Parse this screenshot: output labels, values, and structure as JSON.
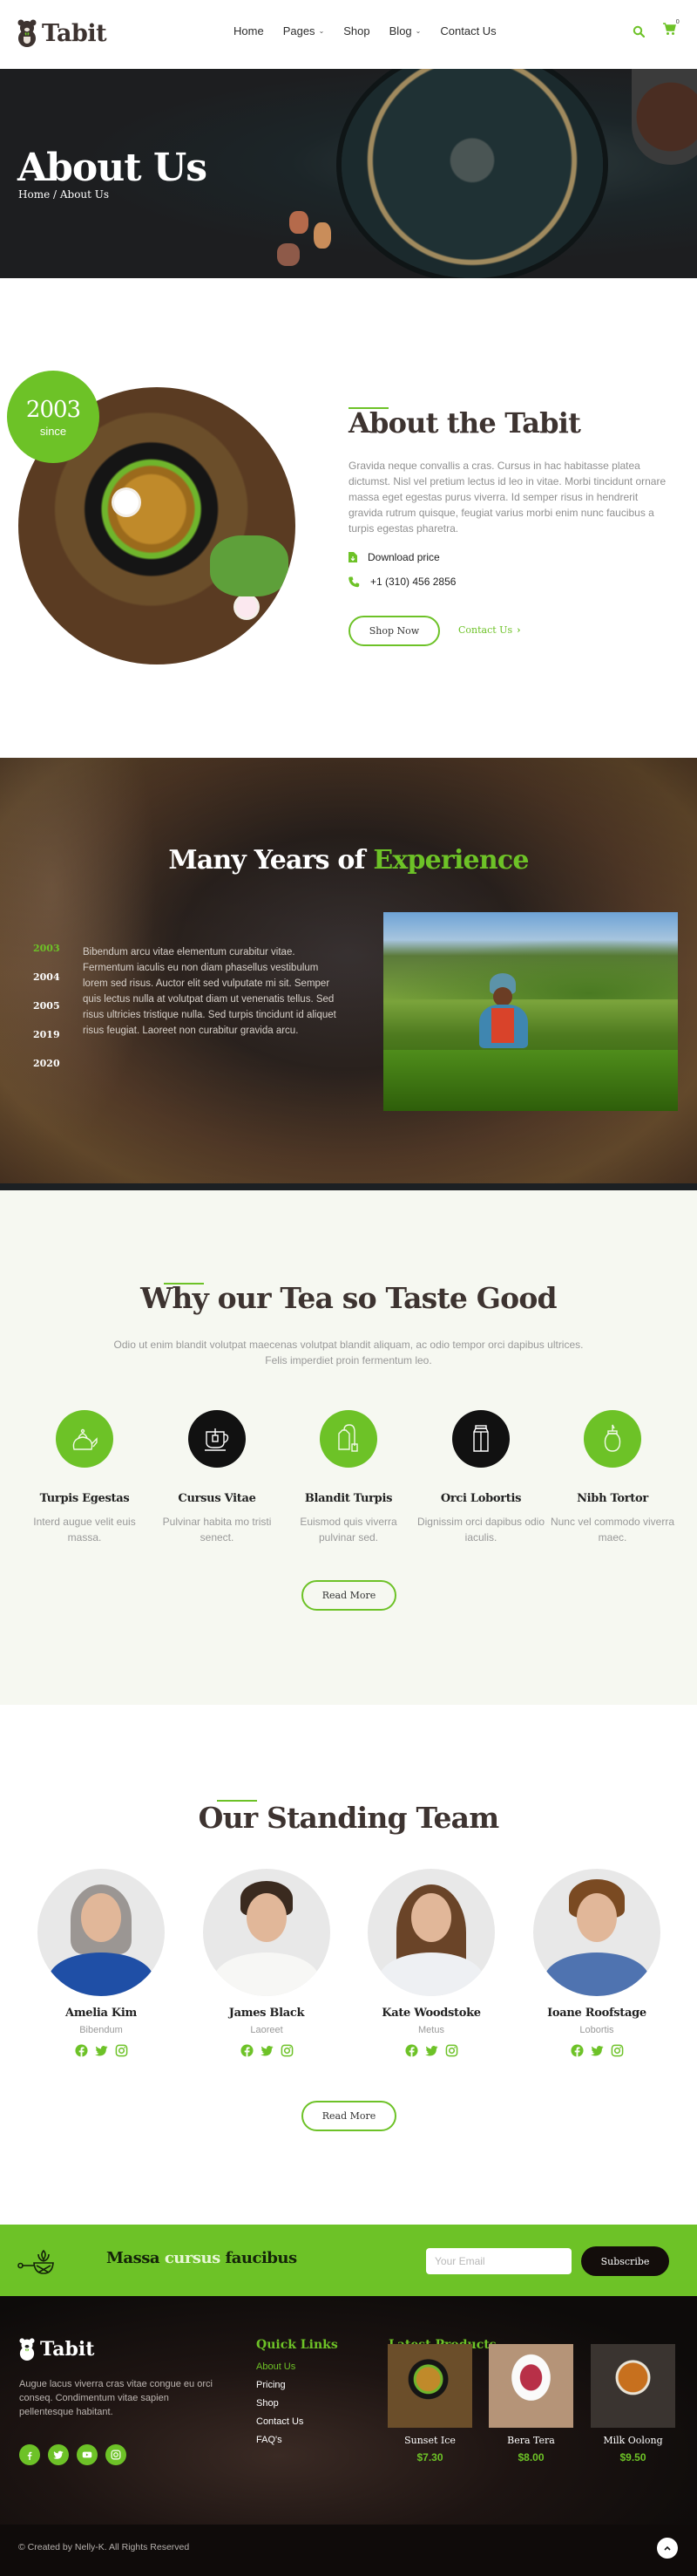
{
  "brand": {
    "name": "Tabit",
    "accent": "#6dc227",
    "dark": "#3d3330"
  },
  "nav": {
    "items": [
      {
        "label": "Home",
        "dropdown": false
      },
      {
        "label": "Pages",
        "dropdown": true
      },
      {
        "label": "Shop",
        "dropdown": false
      },
      {
        "label": "Blog",
        "dropdown": true
      },
      {
        "label": "Contact Us",
        "dropdown": false
      }
    ],
    "cart_count": "0",
    "icons": [
      "search-icon",
      "cart-icon"
    ]
  },
  "hero": {
    "title": "About Us",
    "breadcrumb": "Home / About Us"
  },
  "about": {
    "since_year": "2003",
    "since_label": "since",
    "title": "About the Tabit",
    "text": "Gravida neque convallis a cras. Cursus in hac habitasse platea dictumst. Nisl vel pretium lectus id leo in vitae. Morbi tincidunt ornare massa eget egestas purus viverra. Id semper risus in hendrerit gravida rutrum quisque, feugiat varius morbi enim nunc faucibus a turpis egestas pharetra.",
    "download_label": "Download price",
    "phone": "+1 (310) 456 2856",
    "shop_button": "Shop Now",
    "contact_link": "Contact Us"
  },
  "experience": {
    "title_main": "Many Years of",
    "title_accent": "Experience",
    "years": [
      "2003",
      "2004",
      "2005",
      "2019",
      "2020"
    ],
    "active_year": "2003",
    "text": "Bibendum arcu vitae elementum curabitur vitae. Fermentum iaculis eu non diam phasellus vestibulum lorem sed risus. Auctor elit sed vulputate mi sit. Semper quis lectus nulla at volutpat diam ut venenatis tellus. Sed risus ultricies tristique nulla. Sed turpis tincidunt id aliquet risus feugiat. Laoreet non curabitur gravida arcu."
  },
  "why": {
    "title": "Why our Tea so Taste Good",
    "subtitle": "Odio ut enim blandit volutpat maecenas volutpat blandit aliquam, ac odio tempor orci dapibus ultrices. Felis imperdiet proin fermentum leo.",
    "features": [
      {
        "icon": "kettle-icon",
        "title": "Turpis Egestas",
        "text": "Interd augue velit euis massa.",
        "color": "#6dc227"
      },
      {
        "icon": "tea-cup-icon",
        "title": "Cursus Vitae",
        "text": "Pulvinar habita mo tristi senect.",
        "color": "#111111"
      },
      {
        "icon": "tea-bag-icon",
        "title": "Blandit Turpis",
        "text": "Euismod quis viverra pulvinar sed.",
        "color": "#6dc227"
      },
      {
        "icon": "milk-carton-icon",
        "title": "Orci Lobortis",
        "text": "Dignissim orci dapibus odio iaculis.",
        "color": "#111111"
      },
      {
        "icon": "sugar-jar-icon",
        "title": "Nibh Tortor",
        "text": "Nunc vel commodo viverra maec.",
        "color": "#6dc227"
      }
    ],
    "button": "Read More"
  },
  "team": {
    "title": "Our Standing Team",
    "members": [
      {
        "name": "Amelia Kim",
        "role": "Bibendum"
      },
      {
        "name": "James Black",
        "role": "Laoreet"
      },
      {
        "name": "Kate Woodstoke",
        "role": "Metus"
      },
      {
        "name": "Ioane Roofstage",
        "role": "Lobortis"
      }
    ],
    "socials": [
      "facebook-icon",
      "twitter-icon",
      "instagram-icon"
    ],
    "button": "Read More"
  },
  "newsletter": {
    "title_a": "Massa",
    "title_b": "cursus",
    "title_c": "faucibus",
    "email_placeholder": "Your Email",
    "button": "Subscribe"
  },
  "footer": {
    "brand": "Tabit",
    "text": "Augue lacus viverra cras vitae congue eu orci conseq. Condimentum vitae sapien pellentesque habitant.",
    "socials": [
      "facebook-icon",
      "twitter-icon",
      "youtube-icon",
      "instagram-icon"
    ],
    "quick_links_title": "Quick Links",
    "quick_links": [
      "About Us",
      "Pricing",
      "Shop",
      "Contact Us",
      "FAQ's"
    ],
    "active_link": "About Us",
    "products_title": "Latest Products",
    "products": [
      {
        "name": "Sunset Ice",
        "price": "$7.30"
      },
      {
        "name": "Bera Tera",
        "price": "$8.00"
      },
      {
        "name": "Milk Oolong",
        "price": "$9.50"
      }
    ],
    "copyright": "© Created by Nelly-K. All Rights Reserved"
  }
}
